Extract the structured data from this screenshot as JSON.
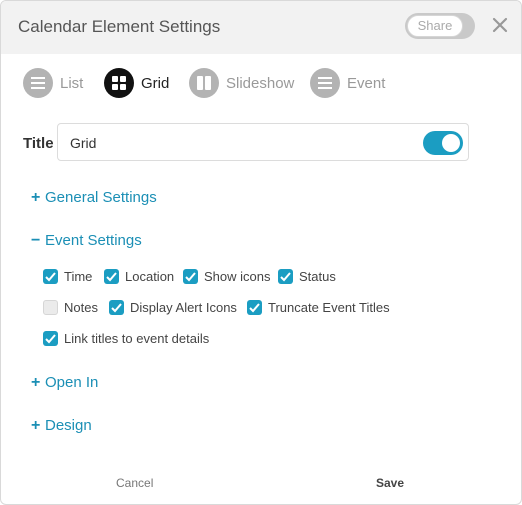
{
  "header": {
    "title": "Calendar Element Settings",
    "share_label": "Share",
    "close_icon": "close-icon"
  },
  "tabs": [
    {
      "label": "List",
      "icon": "list-icon",
      "active": false
    },
    {
      "label": "Grid",
      "icon": "grid-icon",
      "active": true
    },
    {
      "label": "Slideshow",
      "icon": "slideshow-icon",
      "active": false
    },
    {
      "label": "Event",
      "icon": "event-list-icon",
      "active": false
    }
  ],
  "title_field": {
    "label": "Title",
    "value": "Grid",
    "toggle_on": true
  },
  "sections": {
    "general": {
      "label": "General Settings",
      "sign": "+",
      "expanded": false
    },
    "event": {
      "label": "Event Settings",
      "sign": "−",
      "expanded": true
    },
    "open_in": {
      "label": "Open In",
      "sign": "+",
      "expanded": false
    },
    "design": {
      "label": "Design",
      "sign": "+",
      "expanded": false
    }
  },
  "event_options": [
    {
      "label": "Time",
      "checked": true
    },
    {
      "label": "Location",
      "checked": true
    },
    {
      "label": "Show icons",
      "checked": true
    },
    {
      "label": "Status",
      "checked": true
    },
    {
      "label": "Notes",
      "checked": false
    },
    {
      "label": "Display Alert Icons",
      "checked": true
    },
    {
      "label": "Truncate Event Titles",
      "checked": true
    },
    {
      "label": "Link titles to event details",
      "checked": true
    }
  ],
  "footer": {
    "cancel_label": "Cancel",
    "save_label": "Save"
  },
  "colors": {
    "accent": "#1b9dc2",
    "link": "#1b8fb5",
    "header_bg": "#f2f2f2"
  }
}
